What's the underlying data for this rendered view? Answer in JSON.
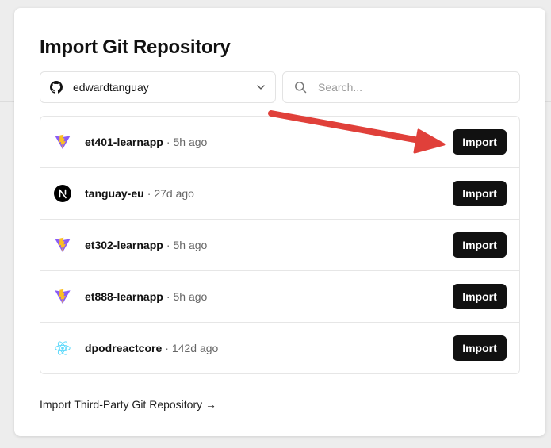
{
  "modal": {
    "title": "Import Git Repository"
  },
  "account": {
    "name": "edwardtanguay",
    "icon": "github-icon"
  },
  "search": {
    "placeholder": "Search...",
    "value": ""
  },
  "separator": "·",
  "repos": [
    {
      "name": "et401-learnapp",
      "time": "5h ago",
      "icon": "vite-icon",
      "button": "Import"
    },
    {
      "name": "tanguay-eu",
      "time": "27d ago",
      "icon": "nextjs-icon",
      "button": "Import"
    },
    {
      "name": "et302-learnapp",
      "time": "5h ago",
      "icon": "vite-icon",
      "button": "Import"
    },
    {
      "name": "et888-learnapp",
      "time": "5h ago",
      "icon": "vite-icon",
      "button": "Import"
    },
    {
      "name": "dpodreactcore",
      "time": "142d ago",
      "icon": "react-icon",
      "button": "Import"
    }
  ],
  "third_party": {
    "label": "Import Third-Party Git Repository →"
  },
  "colors": {
    "button_bg": "#111111",
    "annotation_arrow": "#e0403a"
  }
}
